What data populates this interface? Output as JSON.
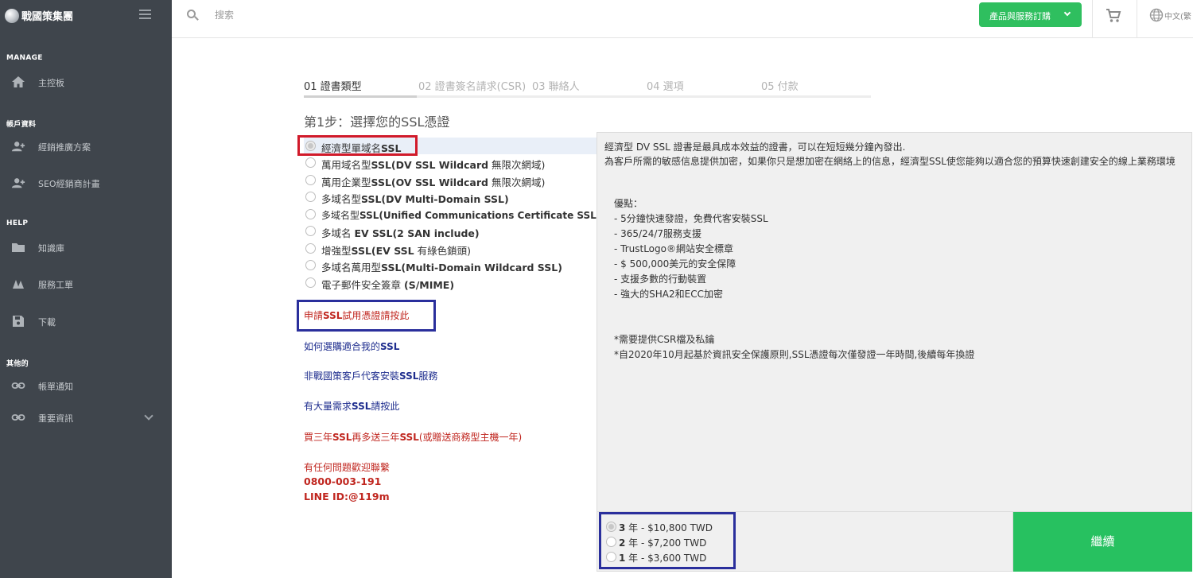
{
  "brand": {
    "name": "戰國策集團"
  },
  "sidebar": {
    "sections": [
      {
        "title": "MANAGE",
        "items": [
          {
            "label": "主控板",
            "icon": "home-icon"
          }
        ]
      },
      {
        "title": "帳戶資料",
        "items": [
          {
            "label": "經銷推廣方案",
            "icon": "add-user-icon"
          },
          {
            "label": "SEO經銷商計畫",
            "icon": "add-user-icon"
          }
        ]
      },
      {
        "title": "HELP",
        "items": [
          {
            "label": "知識庫",
            "icon": "folder-icon"
          },
          {
            "label": "服務工單",
            "icon": "ticket-icon"
          },
          {
            "label": "下載",
            "icon": "save-icon"
          }
        ]
      },
      {
        "title": "其他的",
        "items": [
          {
            "label": "帳單通知",
            "icon": "link-icon"
          },
          {
            "label": "重要資訊",
            "icon": "link-icon"
          }
        ]
      }
    ]
  },
  "topbar": {
    "search_placeholder": "搜索",
    "products_button": "產品與服務訂購",
    "language": "中文(繁"
  },
  "steps": [
    {
      "label": "01 證書類型",
      "active": true
    },
    {
      "label": "02 證書簽名請求(CSR)",
      "active": false
    },
    {
      "label": "03 聯絡人",
      "active": false
    },
    {
      "label": "04 選項",
      "active": false
    },
    {
      "label": "05 付款",
      "active": false
    }
  ],
  "page_title": "第1步：選擇您的SSL憑證",
  "ssl_options": [
    {
      "pre": "經濟型單域名",
      "bold": "SSL",
      "post": "",
      "selected": true
    },
    {
      "pre": "萬用域名型",
      "bold": "SSL(DV SSL Wildcard",
      "post": " 無限次網域)",
      "selected": false
    },
    {
      "pre": "萬用企業型",
      "bold": "SSL(OV SSL Wildcard",
      "post": " 無限次網域)",
      "selected": false
    },
    {
      "pre": "多域名型",
      "bold": "SSL(DV Multi-Domain SSL)",
      "post": "",
      "selected": false
    },
    {
      "pre": "多域名型",
      "bold": "SSL(Unified Communications Certificate SSL)",
      "post": "",
      "selected": false
    },
    {
      "pre": "多域名 ",
      "bold": "EV SSL(2 SAN include)",
      "post": "",
      "selected": false
    },
    {
      "pre": "增強型",
      "bold": "SSL(EV SSL",
      "post": " 有綠色鎖頭)",
      "selected": false
    },
    {
      "pre": "多域名萬用型",
      "bold": "SSL(Multi-Domain Wildcard SSL)",
      "post": "",
      "selected": false
    },
    {
      "pre": "電子郵件安全簽章 ",
      "bold": "(S/MIME)",
      "post": "",
      "selected": false
    }
  ],
  "links": [
    {
      "pre": "申請",
      "bold": "SSL",
      "post": "試用憑證請按此",
      "color": "red"
    },
    {
      "pre": "如何選購適合我的",
      "bold": "SSL",
      "post": "",
      "color": "blue"
    },
    {
      "pre": "非戰國策客戶代客安裝",
      "bold": "SSL",
      "post": "服務",
      "color": "blue"
    },
    {
      "pre": "有大量需求",
      "bold": "SSL",
      "post": "請按此",
      "color": "blue"
    },
    {
      "pre": "買三年",
      "bold": "SSL",
      "post": "再多送三年",
      "bold2": "SSL",
      "post2": "(或贈送商務型主機一年)",
      "color": "red"
    }
  ],
  "contact": {
    "prompt": "有任何問題歡迎聯繫",
    "phone": "0800-003-191",
    "line": "LINE ID:@119m"
  },
  "description": {
    "line1": "經濟型 DV SSL 證書是最具成本效益的證書，可以在短短幾分鐘內發出.",
    "line2": "為客戶所需的敏感信息提供加密，如果你只是想加密在網絡上的信息，經濟型SSL使您能夠以適合您的預算快速創建安全的線上業務環境",
    "advantages_title": "優點：",
    "advantages": [
      "- 5分鐘快速發證，免費代客安裝SSL",
      "- 365/24/7服務支援",
      "- TrustLogo®網站安全標章",
      "- $ 500,000美元的安全保障",
      "- 支援多數的行動裝置",
      "- 強大的SHA2和ECC加密"
    ],
    "notes": [
      "*需要提供CSR檔及私鑰",
      "*自2020年10月起基於資訊安全保護原則,SSL憑證每次僅發證一年時間,後續每年換證"
    ]
  },
  "prices": [
    {
      "years": "3",
      "text": " 年 - $10,800 TWD",
      "selected": true
    },
    {
      "years": "2",
      "text": " 年 - $7,200 TWD",
      "selected": false
    },
    {
      "years": "1",
      "text": " 年 - $3,600 TWD",
      "selected": false
    }
  ],
  "continue_label": "繼續",
  "colors": {
    "sidebar": "#3f454c",
    "green": "#27c160",
    "red": "#c0261f",
    "blue": "#1e2d8e"
  }
}
